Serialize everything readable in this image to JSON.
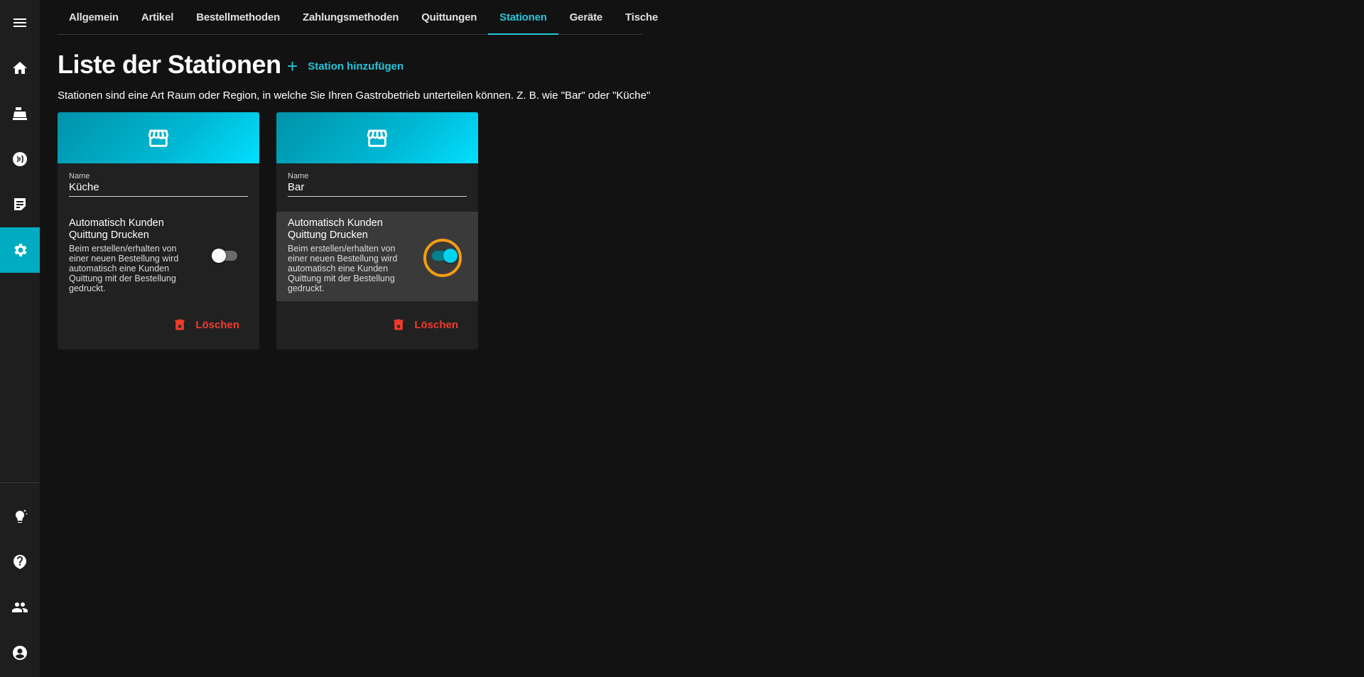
{
  "tabs": [
    "Allgemein",
    "Artikel",
    "Bestellmethoden",
    "Zahlungsmethoden",
    "Quittungen",
    "Stationen",
    "Geräte",
    "Tische"
  ],
  "active_tab": "Stationen",
  "page": {
    "title": "Liste der Stationen",
    "add_label": "Station hinzufügen",
    "description": "Stationen sind eine Art Raum oder Region, in welche Sie Ihren Gastrobetrieb unterteilen können. Z. B. wie \"Bar\" oder \"Küche\""
  },
  "stations": [
    {
      "name_label": "Name",
      "name": "Küche",
      "setting_title": "Automatisch Kunden Quittung Drucken",
      "setting_desc": "Beim erstellen/erhalten von einer neuen Bestellung wird automatisch eine Kunden Quittung mit der Bestellung gedruckt.",
      "auto_print": false,
      "delete_label": "Löschen"
    },
    {
      "name_label": "Name",
      "name": "Bar",
      "setting_title": "Automatisch Kunden Quittung Drucken",
      "setting_desc": "Beim erstellen/erhalten von einer neuen Bestellung wird automatisch eine Kunden Quittung mit der Bestellung gedruckt.",
      "auto_print": true,
      "delete_label": "Löschen"
    }
  ],
  "colors": {
    "accent": "#26c6da",
    "danger": "#ef3b2d",
    "focus": "#f39c12"
  },
  "sidebar_icons": [
    "menu-icon",
    "home-icon",
    "cash-register-icon",
    "nfc-icon",
    "orders-icon",
    "settings-icon",
    "lightbulb-icon",
    "help-icon",
    "users-icon",
    "account-icon"
  ]
}
